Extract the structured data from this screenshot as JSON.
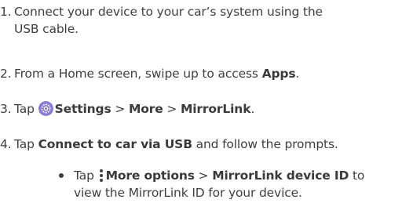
{
  "steps": [
    {
      "number": "1.",
      "line1": "Connect your device to your car’s system using the",
      "line2": "USB cable."
    },
    {
      "number": "2.",
      "text_before": "From a Home screen, swipe up to access ",
      "bold": "Apps",
      "text_after": "."
    },
    {
      "number": "3.",
      "prefix": "Tap ",
      "icon": "settings-icon",
      "bold1": "Settings",
      "sep1": " > ",
      "bold2": "More",
      "sep2": " > ",
      "bold3": "MirrorLink",
      "suffix": "."
    },
    {
      "number": "4.",
      "prefix": "Tap ",
      "bold": "Connect to car via USB",
      "suffix": " and follow the prompts."
    }
  ],
  "substep": {
    "prefix": "Tap ",
    "icon": "more-options-icon",
    "bold1": "More options",
    "sep": " > ",
    "bold2": "MirrorLink device ID",
    "suffix1": " to",
    "line2": "view the MirrorLink ID for your device."
  },
  "colors": {
    "text": "#3f3f3f",
    "settings_icon_bg": "#8a7cd0"
  }
}
